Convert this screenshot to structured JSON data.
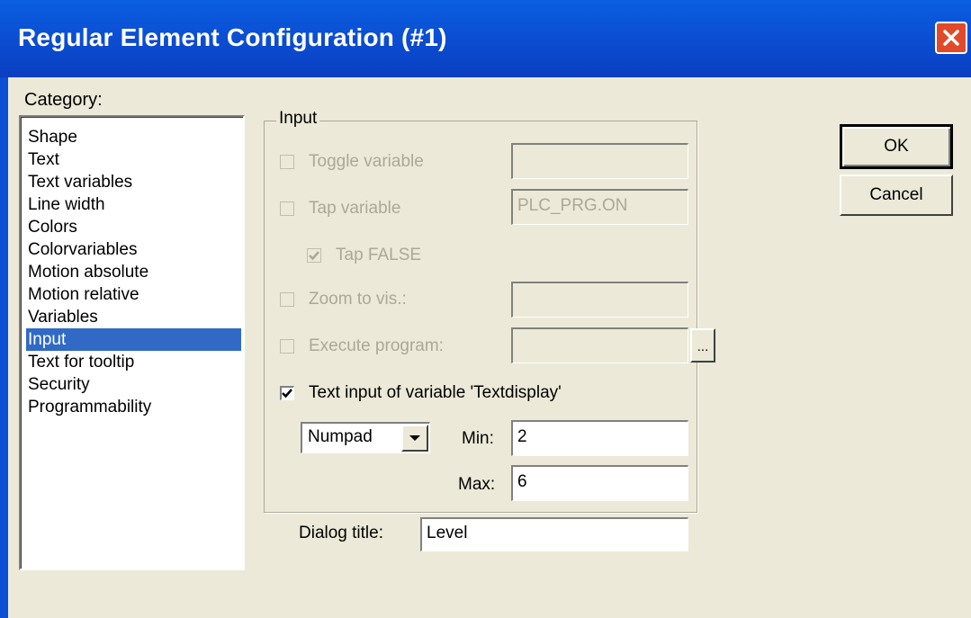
{
  "window": {
    "title": "Regular Element Configuration (#1)"
  },
  "category": {
    "label": "Category:",
    "items": [
      "Shape",
      "Text",
      "Text variables",
      "Line width",
      "Colors",
      "Colorvariables",
      "Motion absolute",
      "Motion relative",
      "Variables",
      "Input",
      "Text for tooltip",
      "Security",
      "Programmability"
    ],
    "selected": "Input"
  },
  "input_group": {
    "legend": "Input",
    "toggle_variable": {
      "label": "Toggle variable",
      "checked": false,
      "value": ""
    },
    "tap_variable": {
      "label": "Tap variable",
      "checked": false,
      "value": "PLC_PRG.ON"
    },
    "tap_false": {
      "label": "Tap FALSE",
      "checked": true
    },
    "zoom_to_vis": {
      "label": "Zoom to vis.:",
      "checked": false,
      "value": ""
    },
    "execute_program": {
      "label": "Execute program:",
      "checked": false,
      "value": "",
      "browse_label": "..."
    },
    "text_input": {
      "label": "Text input of variable 'Textdisplay'",
      "checked": true
    },
    "input_type": {
      "value": "Numpad"
    },
    "min": {
      "label": "Min:",
      "value": "2"
    },
    "max": {
      "label": "Max:",
      "value": "6"
    }
  },
  "dialog_title": {
    "label": "Dialog title:",
    "value": "Level"
  },
  "buttons": {
    "ok": "OK",
    "cancel": "Cancel"
  }
}
